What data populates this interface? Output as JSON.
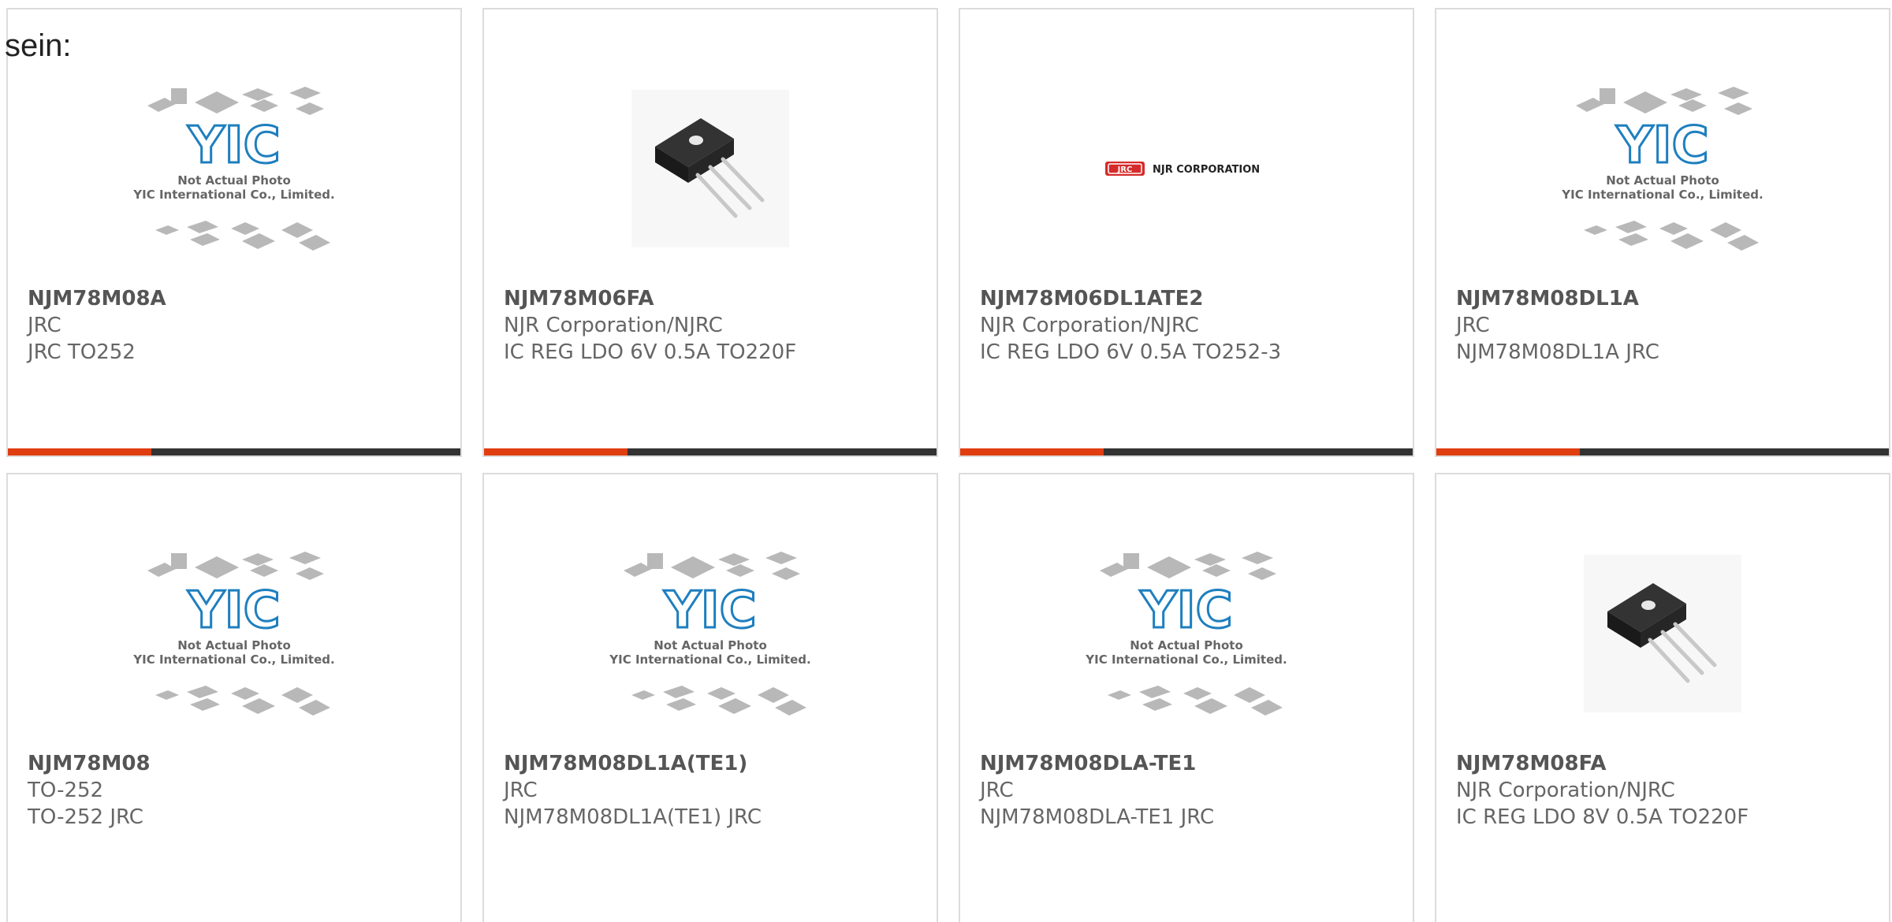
{
  "intro_text": "sein:",
  "placeholder": {
    "brand": "YIC",
    "caption_line1": "Not Actual Photo",
    "caption_line2": "YIC International Co., Limited."
  },
  "njr_logo": {
    "badge": "JRC",
    "name": "NJR CORPORATION"
  },
  "colors": {
    "accent": "#e03d10",
    "bar": "#333333",
    "border": "#dcdcdc"
  },
  "products": [
    {
      "part": "NJM78M08A",
      "line1": "JRC",
      "line2": "JRC TO252",
      "image": "placeholder"
    },
    {
      "part": "NJM78M06FA",
      "line1": "NJR Corporation/NJRC",
      "line2": "IC REG LDO 6V 0.5A TO220F",
      "image": "to220-photo"
    },
    {
      "part": "NJM78M06DL1ATE2",
      "line1": "NJR Corporation/NJRC",
      "line2": "IC REG LDO 6V 0.5A TO252-3",
      "image": "njr-logo"
    },
    {
      "part": "NJM78M08DL1A",
      "line1": "JRC",
      "line2": "NJM78M08DL1A JRC",
      "image": "placeholder"
    },
    {
      "part": "NJM78M08",
      "line1": "TO-252",
      "line2": "TO-252 JRC",
      "image": "placeholder"
    },
    {
      "part": "NJM78M08DL1A(TE1)",
      "line1": "JRC",
      "line2": "NJM78M08DL1A(TE1) JRC",
      "image": "placeholder"
    },
    {
      "part": "NJM78M08DLA-TE1",
      "line1": "JRC",
      "line2": "NJM78M08DLA-TE1 JRC",
      "image": "placeholder"
    },
    {
      "part": "NJM78M08FA",
      "line1": "NJR Corporation/NJRC",
      "line2": "IC REG LDO 8V 0.5A TO220F",
      "image": "to220-photo"
    }
  ]
}
